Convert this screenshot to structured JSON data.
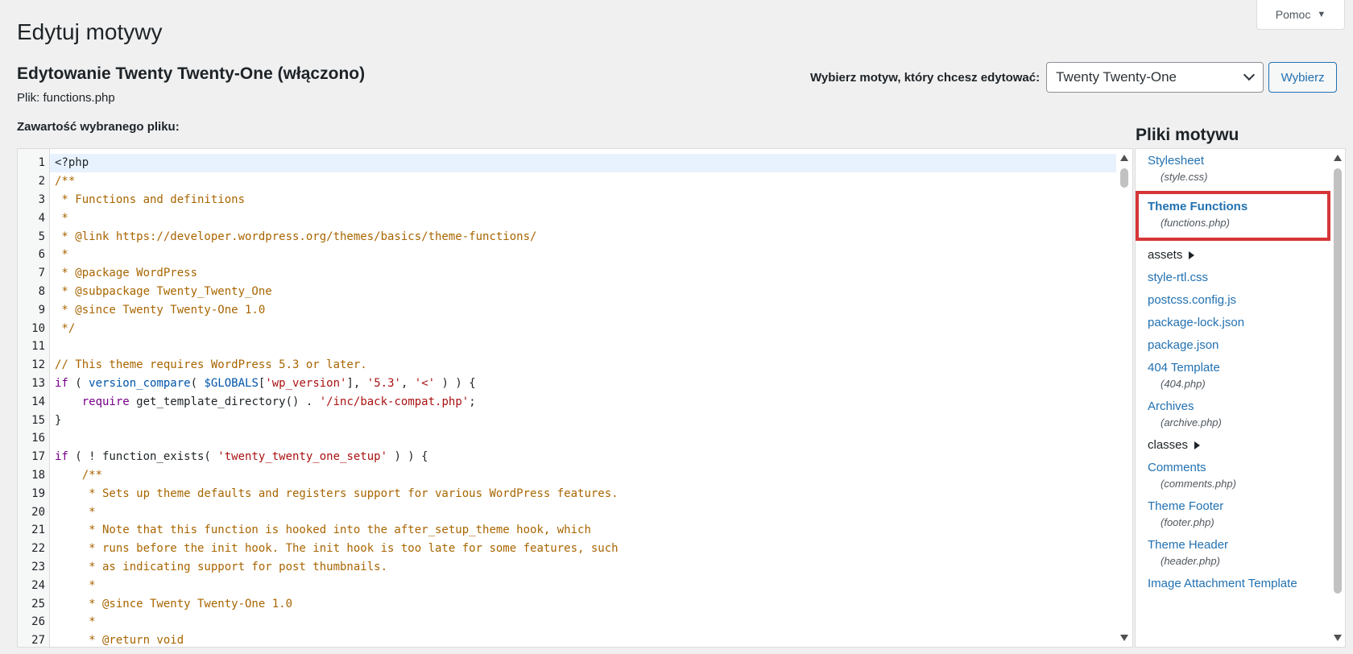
{
  "help": {
    "label": "Pomoc"
  },
  "page": {
    "title": "Edytuj motywy",
    "heading": "Edytowanie Twenty Twenty-One (włączono)",
    "file_prefix": "Plik:",
    "file_name": "functions.php",
    "content_label": "Zawartość wybranego pliku:"
  },
  "theme_selector": {
    "label": "Wybierz motyw, który chcesz edytować:",
    "selected": "Twenty Twenty-One",
    "button": "Wybierz"
  },
  "editor": {
    "active_line": 1,
    "lines": [
      [
        [
          "p",
          "<?php"
        ]
      ],
      [
        [
          "c",
          "/**"
        ]
      ],
      [
        [
          "c",
          " * Functions and definitions"
        ]
      ],
      [
        [
          "c",
          " *"
        ]
      ],
      [
        [
          "c",
          " * @link https://developer.wordpress.org/themes/basics/theme-functions/"
        ]
      ],
      [
        [
          "c",
          " *"
        ]
      ],
      [
        [
          "c",
          " * @package WordPress"
        ]
      ],
      [
        [
          "c",
          " * @subpackage Twenty_Twenty_One"
        ]
      ],
      [
        [
          "c",
          " * @since Twenty Twenty-One 1.0"
        ]
      ],
      [
        [
          "c",
          " */"
        ]
      ],
      [],
      [
        [
          "c",
          "// This theme requires WordPress 5.3 or later."
        ]
      ],
      [
        [
          "k",
          "if"
        ],
        [
          "p",
          " ( "
        ],
        [
          "v",
          "version_compare"
        ],
        [
          "p",
          "( "
        ],
        [
          "v",
          "$GLOBALS"
        ],
        [
          "p",
          "["
        ],
        [
          "s",
          "'wp_version'"
        ],
        [
          "p",
          "], "
        ],
        [
          "s",
          "'5.3'"
        ],
        [
          "p",
          ", "
        ],
        [
          "s",
          "'<'"
        ],
        [
          "p",
          " ) ) {"
        ]
      ],
      [
        [
          "p",
          "    "
        ],
        [
          "k",
          "require"
        ],
        [
          "p",
          " get_template_directory() . "
        ],
        [
          "s",
          "'/inc/back-compat.php'"
        ],
        [
          "p",
          ";"
        ]
      ],
      [
        [
          "p",
          "}"
        ]
      ],
      [],
      [
        [
          "k",
          "if"
        ],
        [
          "p",
          " ( ! function_exists( "
        ],
        [
          "s",
          "'twenty_twenty_one_setup'"
        ],
        [
          "p",
          " ) ) {"
        ]
      ],
      [
        [
          "c",
          "    /**"
        ]
      ],
      [
        [
          "c",
          "     * Sets up theme defaults and registers support for various WordPress features."
        ]
      ],
      [
        [
          "c",
          "     *"
        ]
      ],
      [
        [
          "c",
          "     * Note that this function is hooked into the after_setup_theme hook, which"
        ]
      ],
      [
        [
          "c",
          "     * runs before the init hook. The init hook is too late for some features, such"
        ]
      ],
      [
        [
          "c",
          "     * as indicating support for post thumbnails."
        ]
      ],
      [
        [
          "c",
          "     *"
        ]
      ],
      [
        [
          "c",
          "     * @since Twenty Twenty-One 1.0"
        ]
      ],
      [
        [
          "c",
          "     *"
        ]
      ],
      [
        [
          "c",
          "     * @return void"
        ]
      ]
    ]
  },
  "files": {
    "title": "Pliki motywu",
    "items": [
      {
        "type": "file",
        "name": "Stylesheet",
        "sub": "(style.css)"
      },
      {
        "type": "file",
        "name": "Theme Functions",
        "sub": "(functions.php)",
        "current": true
      },
      {
        "type": "folder",
        "name": "assets"
      },
      {
        "type": "file",
        "name": "style-rtl.css"
      },
      {
        "type": "file",
        "name": "postcss.config.js"
      },
      {
        "type": "file",
        "name": "package-lock.json"
      },
      {
        "type": "file",
        "name": "package.json"
      },
      {
        "type": "file",
        "name": "404 Template",
        "sub": "(404.php)"
      },
      {
        "type": "file",
        "name": "Archives",
        "sub": "(archive.php)"
      },
      {
        "type": "folder",
        "name": "classes"
      },
      {
        "type": "file",
        "name": "Comments",
        "sub": "(comments.php)"
      },
      {
        "type": "file",
        "name": "Theme Footer",
        "sub": "(footer.php)"
      },
      {
        "type": "file",
        "name": "Theme Header",
        "sub": "(header.php)"
      },
      {
        "type": "file",
        "name": "Image Attachment Template"
      }
    ]
  },
  "colors": {
    "link": "#2271b1",
    "highlight_border": "#d63638",
    "active_line": "#e8f2fe",
    "comment": "#a86500"
  }
}
